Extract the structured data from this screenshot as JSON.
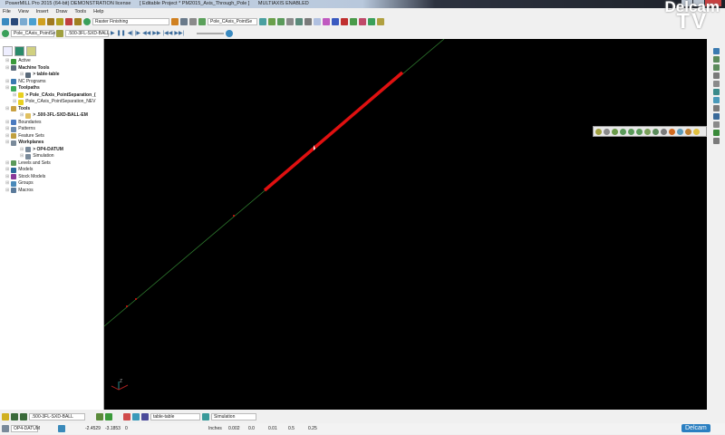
{
  "title": {
    "app": "PowerMILL Pro 2015 (64-bit) DEMONSTRATION license",
    "project": "[ Editable Project * PM2015_Axis_Through_Pole ]",
    "mode": "MULTIAXIS ENABLED"
  },
  "menu": [
    "File",
    "View",
    "Insert",
    "Draw",
    "Tools",
    "Help"
  ],
  "toolbar1": {
    "strategy": "Raster Finishing",
    "toolpath": "Pole_CAxis_PointSe"
  },
  "toolbar2": {
    "toolpath": "Pole_CAxis_PointSe",
    "tool": ".500-3FL-SXD-BALL"
  },
  "explorer": {
    "items": [
      {
        "label": "Active",
        "bold": false,
        "indent": 0,
        "color": "#3a9a3a"
      },
      {
        "label": "Machine Tools",
        "bold": true,
        "indent": 0,
        "color": "#5a6a7a"
      },
      {
        "label": "> table-table",
        "bold": true,
        "indent": 2,
        "color": "#5a6a7a"
      },
      {
        "label": "NC Programs",
        "bold": false,
        "indent": 0,
        "color": "#3a7ab0"
      },
      {
        "label": "Toolpaths",
        "bold": true,
        "indent": 0,
        "color": "#3aaa5a"
      },
      {
        "label": "> Pole_CAxis_PointSeparation_(",
        "bold": true,
        "indent": 1,
        "color": "#e8d020"
      },
      {
        "label": "Pole_CAxis_PointSeparation_NEV",
        "bold": false,
        "indent": 1,
        "color": "#e8d020"
      },
      {
        "label": "Tools",
        "bold": true,
        "indent": 0,
        "color": "#c8a040"
      },
      {
        "label": "> .500-3FL-SXD-BALL-EM",
        "bold": true,
        "indent": 2,
        "color": "#e0c060"
      },
      {
        "label": "Boundaries",
        "bold": false,
        "indent": 0,
        "color": "#4a7ac0"
      },
      {
        "label": "Patterns",
        "bold": false,
        "indent": 0,
        "color": "#6a8ab0"
      },
      {
        "label": "Feature Sets",
        "bold": false,
        "indent": 0,
        "color": "#c0a040"
      },
      {
        "label": "Workplanes",
        "bold": true,
        "indent": 0,
        "color": "#7a8a9a"
      },
      {
        "label": "> OP4-DATUM",
        "bold": true,
        "indent": 2,
        "color": "#7a8a9a"
      },
      {
        "label": "Simulation",
        "bold": false,
        "indent": 2,
        "color": "#7a8a9a"
      },
      {
        "label": "Levels and Sets",
        "bold": false,
        "indent": 0,
        "color": "#5a9a5a"
      },
      {
        "label": "Models",
        "bold": false,
        "indent": 0,
        "color": "#2a6a9a"
      },
      {
        "label": "Stock Models",
        "bold": false,
        "indent": 0,
        "color": "#8a3a9a"
      },
      {
        "label": "Groups",
        "bold": false,
        "indent": 0,
        "color": "#4a8aba"
      },
      {
        "label": "Macros",
        "bold": false,
        "indent": 0,
        "color": "#5a7a9a"
      }
    ]
  },
  "bottom1": {
    "tool": ".500-3FL-SXD-BALL",
    "machine": "table-table",
    "simulation": "Simulation"
  },
  "bottom2": {
    "workplane": "OP4-DATUM",
    "x": "-2.4529",
    "y": "-3.1853",
    "z": "0",
    "units": "Inches",
    "tolerance": "0.002",
    "thickness": "0.0",
    "stepover": "0.01",
    "v1": "0.5",
    "v2": "0.25"
  },
  "logo": {
    "line1": "Delcam",
    "line2": "TV",
    "brand": "Delcam"
  }
}
